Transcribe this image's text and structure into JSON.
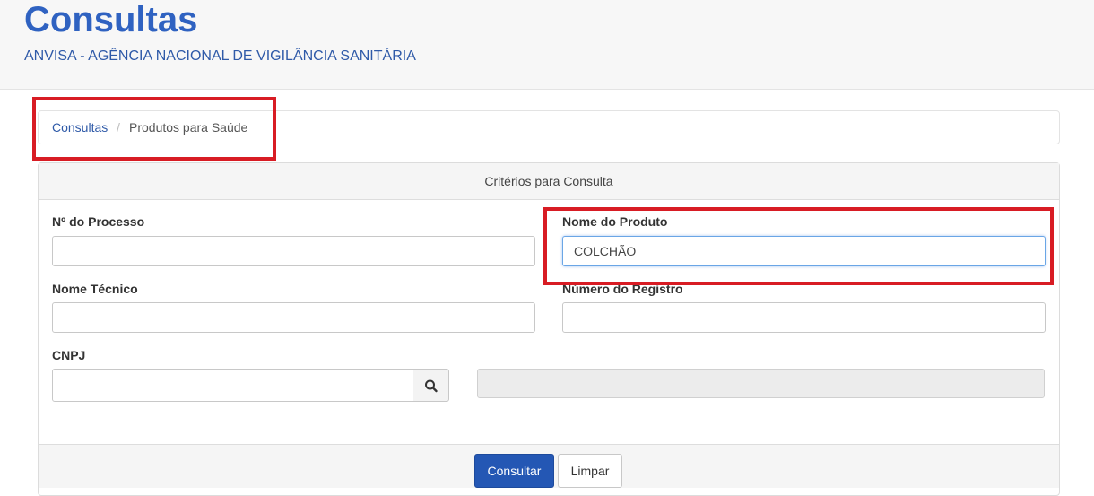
{
  "header": {
    "title": "Consultas",
    "subtitle": "ANVISA - AGÊNCIA NACIONAL DE VIGILÂNCIA SANITÁRIA"
  },
  "breadcrumb": {
    "items": [
      {
        "label": "Consultas",
        "link": true
      },
      {
        "label": "Produtos para Saúde",
        "link": false
      }
    ],
    "separator": "/"
  },
  "panel": {
    "heading": "Critérios para Consulta"
  },
  "form": {
    "numero_processo": {
      "label": "Nº do Processo",
      "value": ""
    },
    "nome_produto": {
      "label": "Nome do Produto",
      "value": "COLCHÃO"
    },
    "nome_tecnico": {
      "label": "Nome Técnico",
      "value": ""
    },
    "numero_registro": {
      "label": "Número do Registro",
      "value": ""
    },
    "cnpj": {
      "label": "CNPJ",
      "value": ""
    },
    "empresa": {
      "value": ""
    }
  },
  "buttons": {
    "consultar": "Consultar",
    "limpar": "Limpar"
  },
  "colors": {
    "accent": "#2f62c1",
    "primary_button": "#2457b4",
    "highlight": "#d81c24"
  },
  "icons": {
    "cnpj_search": "search-icon"
  }
}
